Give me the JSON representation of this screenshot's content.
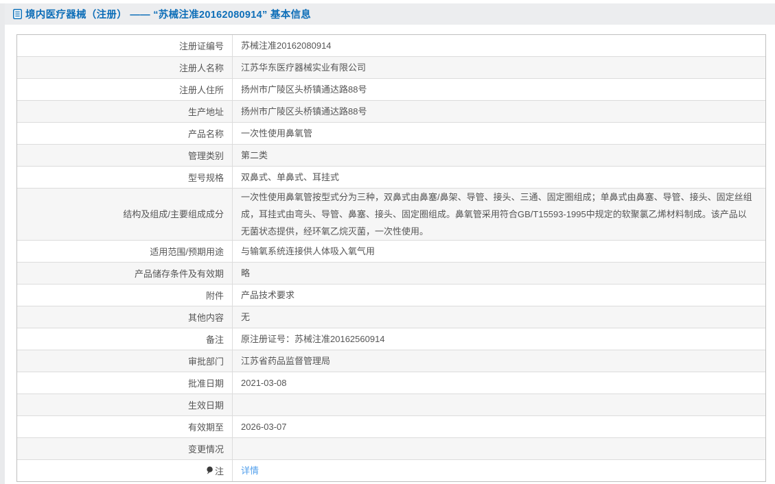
{
  "header": {
    "title": "境内医疗器械（注册） —— “苏械注准20162080914” 基本信息"
  },
  "colors": {
    "title_blue": "#0d6eb8",
    "link_blue": "#53a0ec",
    "band_bg": "#ecedef",
    "stripe_bg": "#f6f6f6",
    "outer_border": "#bfbfbf",
    "inner_border": "#dcdcdc",
    "text": "#555555"
  },
  "icons": {
    "title_icon": "document-icon",
    "note_icon": "balloon-icon"
  },
  "table": {
    "rows": [
      {
        "label": "注册证编号",
        "value": "苏械注准20162080914"
      },
      {
        "label": "注册人名称",
        "value": "江苏华东医疗器械实业有限公司"
      },
      {
        "label": "注册人住所",
        "value": "扬州市广陵区头桥镇通达路88号"
      },
      {
        "label": "生产地址",
        "value": "扬州市广陵区头桥镇通达路88号"
      },
      {
        "label": "产品名称",
        "value": "一次性使用鼻氧管"
      },
      {
        "label": "管理类别",
        "value": "第二类"
      },
      {
        "label": "型号规格",
        "value": "双鼻式、单鼻式、耳挂式"
      },
      {
        "label": "结构及组成/主要组成成分",
        "value": "一次性使用鼻氧管按型式分为三种，双鼻式由鼻塞/鼻架、导管、接头、三通、固定圈组成；单鼻式由鼻塞、导管、接头、固定丝组成，耳挂式由弯头、导管、鼻塞、接头、固定圈组成。鼻氧管采用符合GB/T15593-1995中规定的软聚氯乙烯材料制成。该产品以无菌状态提供，经环氧乙烷灭菌，一次性使用。",
        "tall": true
      },
      {
        "label": "适用范围/预期用途",
        "value": "与输氧系统连接供人体吸入氧气用"
      },
      {
        "label": "产品储存条件及有效期",
        "value": "略"
      },
      {
        "label": "附件",
        "value": "产品技术要求"
      },
      {
        "label": "其他内容",
        "value": "无"
      },
      {
        "label": "备注",
        "value": "原注册证号：苏械注准20162560914"
      },
      {
        "label": "审批部门",
        "value": "江苏省药品监督管理局"
      },
      {
        "label": "批准日期",
        "value": "2021-03-08"
      },
      {
        "label": "生效日期",
        "value": ""
      },
      {
        "label": "有效期至",
        "value": "2026-03-07"
      },
      {
        "label": "变更情况",
        "value": ""
      },
      {
        "label": "注",
        "label_icon": "balloon-icon",
        "link": "详情"
      }
    ]
  }
}
